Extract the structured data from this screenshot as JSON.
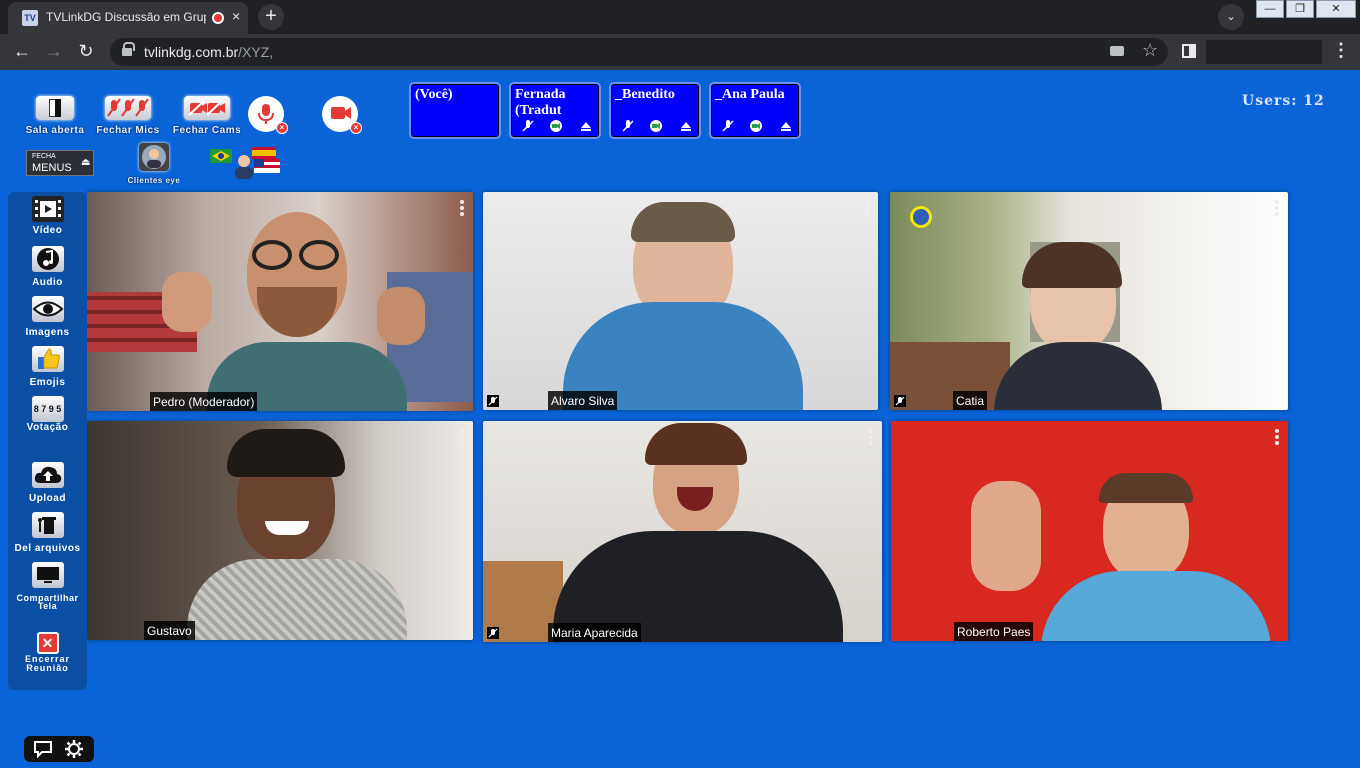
{
  "browser": {
    "tab_title": "TVLinkDG Discussão em Grupo",
    "tab_favicon": "TV",
    "tab_close": "×",
    "new_tab": "+",
    "tab_search": "⌄",
    "url_domain": "tvlinkdg.com.br",
    "url_path": "/XYZ,",
    "back": "←",
    "forward": "→",
    "reload": "↻",
    "window_minimize": "—",
    "window_restore": "❐",
    "window_close": "✕"
  },
  "toolbar": {
    "sala_aberta": "Sala aberta",
    "fechar_mics": "Fechar Mics",
    "fechar_cams": "Fechar Cams",
    "fecha_menus_top": "FECHA",
    "fecha_menus_bottom": "MENUS",
    "clientes_eye": "Clientes eye"
  },
  "users_label": "Users: 12",
  "participants": [
    {
      "name": "(Você)",
      "controls": false
    },
    {
      "name": "Fernada (Tradut",
      "controls": true
    },
    {
      "name": "_Benedito",
      "controls": true
    },
    {
      "name": "_Ana Paula",
      "controls": true
    }
  ],
  "left_menu": [
    {
      "label": "Vídeo",
      "icon": "film-icon"
    },
    {
      "label": "Audio",
      "icon": "music-note-icon"
    },
    {
      "label": "Imagens",
      "icon": "eye-icon"
    },
    {
      "label": "Emojis",
      "icon": "thumbs-up-icon"
    },
    {
      "label": "Votação",
      "icon": "numbers-icon",
      "glyph": "8 7 9 5"
    },
    {
      "label": "Upload",
      "icon": "cloud-upload-icon"
    },
    {
      "label": "Del arquivos",
      "icon": "trash-icon"
    },
    {
      "label": "Compartilhar Tela",
      "icon": "monitor-icon"
    },
    {
      "label": "Encerrar Reunião",
      "icon": "close-red-icon"
    }
  ],
  "videos": [
    {
      "name": "Pedro (Moderador)"
    },
    {
      "name": "Alvaro Silva"
    },
    {
      "name": "Catia"
    },
    {
      "name": "Gustavo"
    },
    {
      "name": "Maria Aparecida"
    },
    {
      "name": "Roberto Paes"
    }
  ],
  "colors": {
    "page_bg": "#0a64d8",
    "participant_box": "#0000ff",
    "left_menu": "#0a4fa3",
    "tile_red_bg": "#d8281f"
  }
}
